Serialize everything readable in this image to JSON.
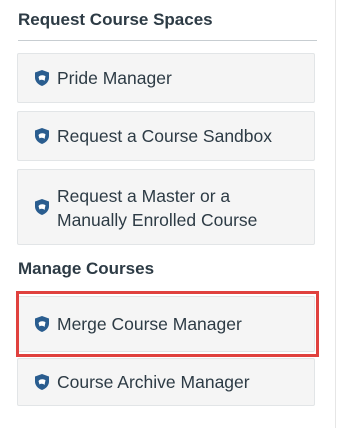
{
  "sections": [
    {
      "heading": "Request Course Spaces",
      "items": [
        {
          "label": "Pride Manager",
          "icon": "shield-icon"
        },
        {
          "label": "Request a Course Sandbox",
          "icon": "shield-icon"
        },
        {
          "label": "Request a Master or a Manually Enrolled Course",
          "icon": "shield-icon"
        }
      ]
    },
    {
      "heading": "Manage Courses",
      "items": [
        {
          "label": "Merge Course Manager",
          "icon": "shield-icon",
          "highlighted": true
        },
        {
          "label": "Course Archive Manager",
          "icon": "shield-icon"
        }
      ]
    }
  ],
  "colors": {
    "highlight_border": "#e0413e",
    "tile_background": "#f5f5f5",
    "icon_color": "#2a5d8f",
    "text": "#2d3b45"
  }
}
